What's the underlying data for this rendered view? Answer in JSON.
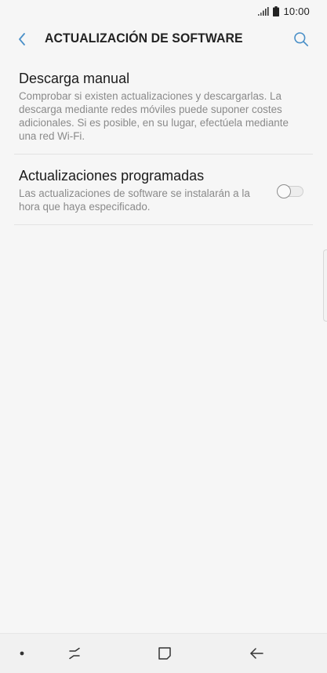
{
  "status_bar": {
    "time": "10:00",
    "icons": [
      "signal-icon",
      "battery-icon"
    ]
  },
  "app_bar": {
    "title": "ACTUALIZACIÓN DE SOFTWARE",
    "back_icon": "chevron-left-icon",
    "search_icon": "search-icon"
  },
  "settings": [
    {
      "title": "Descarga manual",
      "description": "Comprobar si existen actualizaciones y descargarlas. La descarga mediante redes móviles puede suponer costes adicionales. Si es posible, en su lugar, efectúela mediante una red Wi-Fi."
    },
    {
      "title": "Actualizaciones programadas",
      "description": "Las actualizaciones de software se instalarán a la hora que haya especificado.",
      "toggle_on": false
    }
  ],
  "nav_bar": {
    "items": [
      "dot-icon",
      "recent-apps-icon",
      "home-icon",
      "back-arrow-icon"
    ]
  },
  "colors": {
    "background": "#f6f6f6",
    "accent": "#4a90c8",
    "title_text": "#222222",
    "secondary_text": "#8a8a8a"
  }
}
